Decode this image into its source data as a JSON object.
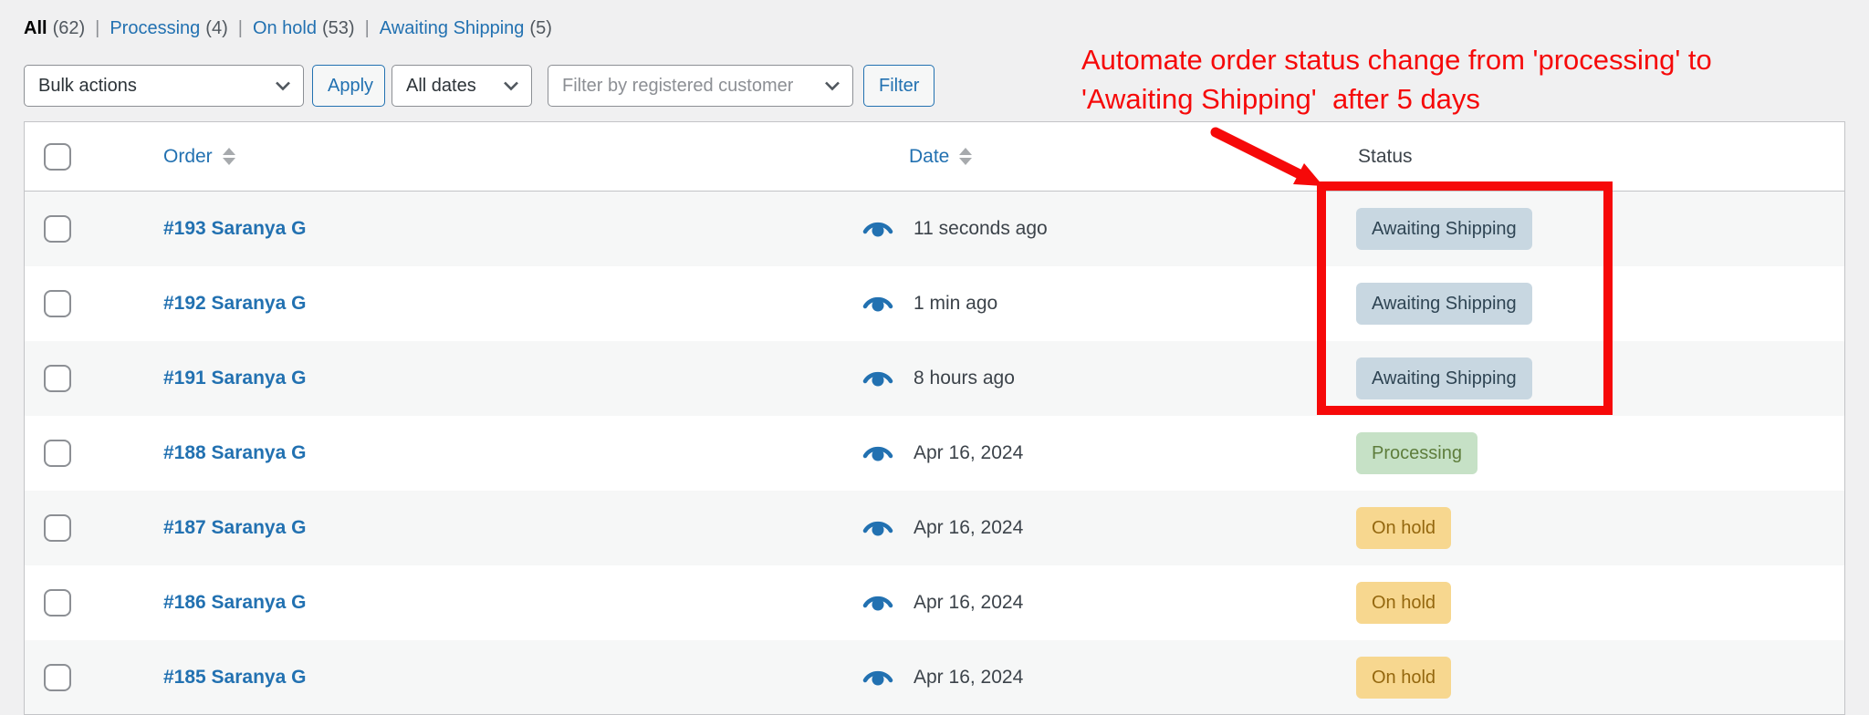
{
  "colors": {
    "accent_blue": "#2271b1",
    "annotation_red": "#f60909",
    "page_bg": "#f0f0f1",
    "table_border": "#c3c4c7",
    "stripe": "#f6f7f7",
    "text_dark": "#3c434a"
  },
  "status_filters": {
    "separator": "|",
    "views": [
      {
        "label": "All",
        "count": "(62)",
        "current": true
      },
      {
        "label": "Processing",
        "count": "(4)",
        "current": false
      },
      {
        "label": "On hold",
        "count": "(53)",
        "current": false
      },
      {
        "label": "Awaiting Shipping",
        "count": "(5)",
        "current": false
      }
    ]
  },
  "toolbar": {
    "bulk_actions": {
      "value": "Bulk actions"
    },
    "apply_label": "Apply",
    "date_filter": {
      "value": "All dates"
    },
    "customer_filter": {
      "placeholder": "Filter by registered customer"
    },
    "filter_label": "Filter"
  },
  "annotation": {
    "line1": "Automate order status change from 'processing' to",
    "line2": "'Awaiting Shipping'  after 5 days"
  },
  "table": {
    "columns": {
      "order": "Order",
      "date": "Date",
      "status": "Status"
    },
    "rows": [
      {
        "order": "#193 Saranya G",
        "date": "11 seconds ago",
        "status": "Awaiting Shipping",
        "status_key": "awaiting"
      },
      {
        "order": "#192 Saranya G",
        "date": "1 min ago",
        "status": "Awaiting Shipping",
        "status_key": "awaiting"
      },
      {
        "order": "#191 Saranya G",
        "date": "8 hours ago",
        "status": "Awaiting Shipping",
        "status_key": "awaiting"
      },
      {
        "order": "#188 Saranya G",
        "date": "Apr 16, 2024",
        "status": "Processing",
        "status_key": "processing"
      },
      {
        "order": "#187 Saranya G",
        "date": "Apr 16, 2024",
        "status": "On hold",
        "status_key": "on_hold"
      },
      {
        "order": "#186 Saranya G",
        "date": "Apr 16, 2024",
        "status": "On hold",
        "status_key": "on_hold"
      },
      {
        "order": "#185 Saranya G",
        "date": "Apr 16, 2024",
        "status": "On hold",
        "status_key": "on_hold"
      }
    ]
  },
  "status_colors": {
    "awaiting": {
      "bg": "#c8d7e1",
      "text": "#2e4453"
    },
    "processing": {
      "bg": "#c6e1c6",
      "text": "#5e7d3c"
    },
    "on_hold": {
      "bg": "#f7d78f",
      "text": "#94670e"
    }
  },
  "icons": {
    "preview": "eye-icon",
    "sort": "sort-toggle-icon",
    "select_chevron": "chevron-down-icon"
  }
}
